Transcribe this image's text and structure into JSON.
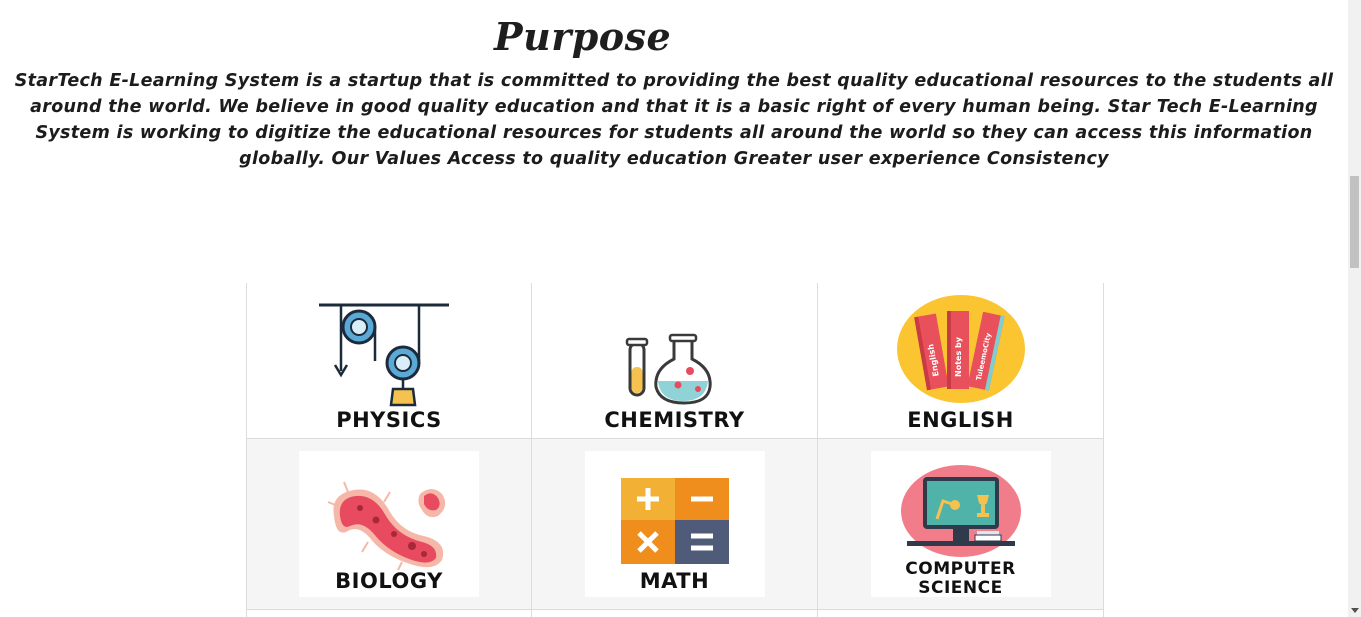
{
  "heading": "Purpose",
  "purpose_text": "StarTech E-Learning System is a startup that is committed to providing the best quality educational resources to the students all around the world. We believe in good quality education and that it is a basic right of every human being. Star Tech E-Learning System is working to digitize the educational resources for students all around the world so they can access this information globally. Our Values Access to quality education Greater user experience Consistency",
  "subjects": {
    "physics": {
      "label": "PHYSICS",
      "icon": "pulley-icon"
    },
    "chemistry": {
      "label": "CHEMISTRY",
      "icon": "flask-icon"
    },
    "english": {
      "label": "ENGLISH",
      "icon": "books-icon",
      "book_spines": [
        "English",
        "Notes by",
        "TuleemoCity"
      ]
    },
    "biology": {
      "label": "BIOLOGY",
      "icon": "bacteria-icon"
    },
    "math": {
      "label": "MATH",
      "icon": "math-operators-icon"
    },
    "computer_science": {
      "label_line1": "COMPUTER",
      "label_line2": "SCIENCE",
      "icon": "computer-desk-icon"
    }
  },
  "colors": {
    "physics_blue": "#5aa9d6",
    "chemistry_teal": "#8fd3d6",
    "english_yellow": "#fbc531",
    "english_red": "#e8505b",
    "biology_red": "#e84a5f",
    "math_yellow": "#f2b134",
    "math_orange": "#ef8e1c",
    "math_slate": "#4f5b79",
    "cs_pink": "#f27d8a",
    "cs_teal": "#4fb3a9"
  }
}
